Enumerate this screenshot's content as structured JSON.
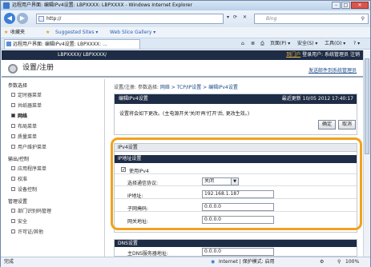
{
  "window": {
    "title": "远程用户界面: 编辑IPv4设置: LBPXXXX: LBPXXXX - Windows Internet Explorer"
  },
  "address": {
    "url": "http://",
    "search_placeholder": "Bing"
  },
  "favorites": {
    "label": "收藏夹",
    "suggested": "Suggested Sites ▾",
    "gallery": "Web Slice Gallery ▾"
  },
  "tab": {
    "label": "远程用户界面: 编辑IPv4设置: LBPXXXX: ..."
  },
  "tools": {
    "page": "页面(P) ▾",
    "safety": "安全(S) ▾",
    "tools": "工具(O) ▾",
    "help": "? ▾"
  },
  "app": {
    "device": "LBPXXXX/ LBPXXXX/",
    "to_portal": "到门户",
    "login_user": "登录用户: 系统管理员",
    "logout": "注销",
    "page_title": "设置/注册",
    "mail": "发送邮件到系统管理员"
  },
  "sidebar": {
    "sections": [
      {
        "title": "参数选择",
        "items": [
          "定时器菜单",
          "共纸器菜单",
          "网络",
          "布局菜单",
          "质量菜单",
          "用户维护菜单"
        ]
      },
      {
        "title": "输出/控制",
        "items": [
          "应用程序菜单",
          "校准",
          "设备控制"
        ]
      },
      {
        "title": "管理设置",
        "items": [
          "部门识别码管理",
          "安全",
          "许可证/其他"
        ]
      }
    ]
  },
  "breadcrumb": {
    "prefix": "设置/注册: 参数选择: ",
    "path": "网络 > TCP/IP设置 > 编辑IPv4设置"
  },
  "panel": {
    "title": "编辑IPv4设置",
    "updated": "最近更新 10/05 2012 17:40:17",
    "message": "设置将会如下更改。(主电源开关'关闭'再'打开'后, 更改生效。)",
    "ok": "确定",
    "cancel": "取消"
  },
  "ipv4": {
    "section": "IPv4设置",
    "subsection": "IP地址设置",
    "use_ipv4": "使用IPv4",
    "use_ipv4_checked": "✓",
    "protocol_label": "选择通信协议:",
    "protocol_value": "关闭",
    "ip_label": "IP地址:",
    "ip_value": "192.168.1.187",
    "mask_label": "子网掩码:",
    "mask_value": "0.0.0.0",
    "gateway_label": "网关地址:",
    "gateway_value": "0.0.0.0"
  },
  "dns": {
    "section": "DNS设置",
    "primary_label": "主DNS服务器地址:",
    "primary_value": "0.0.0.0"
  },
  "status": {
    "left": "完成",
    "zone": "Internet | 保护模式: 启用",
    "zoom": "100%"
  },
  "colors": {
    "accent": "#f2a21c",
    "header": "#1e2c45"
  }
}
